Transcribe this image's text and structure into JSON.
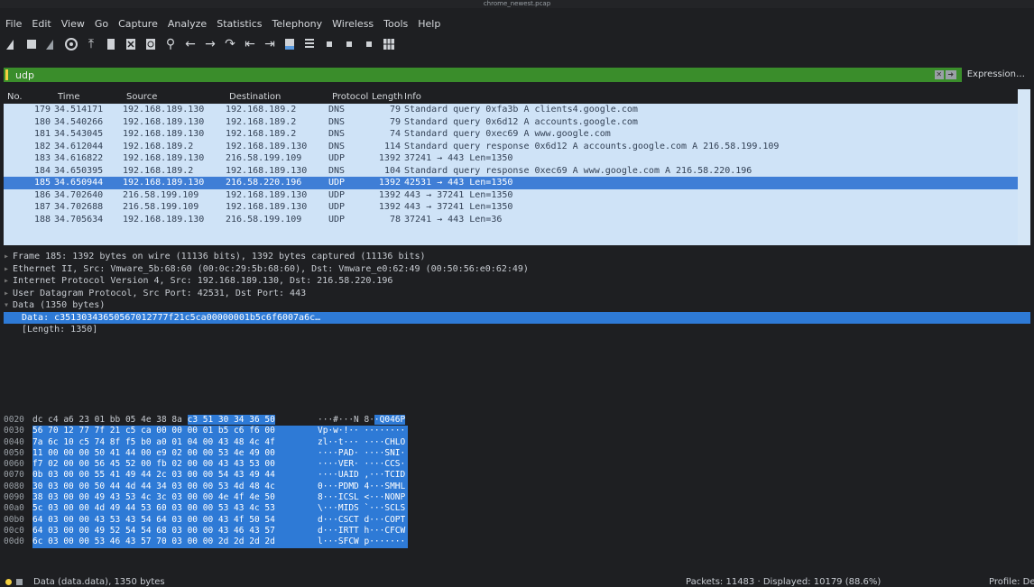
{
  "window": {
    "title": "chrome_newest.pcap"
  },
  "menu": [
    "File",
    "Edit",
    "View",
    "Go",
    "Capture",
    "Analyze",
    "Statistics",
    "Telephony",
    "Wireless",
    "Tools",
    "Help"
  ],
  "toolbar": {
    "icons": [
      "shark-fin-start-icon",
      "stop-square-icon",
      "shark-fin-restart-icon",
      "gear-icon",
      "open-icon",
      "file-icon",
      "close-file-icon",
      "reload-icon",
      "search-icon",
      "back-arrow-icon",
      "forward-arrow-icon",
      "jump-icon",
      "first-packet-icon",
      "last-packet-icon",
      "autoscroll-icon",
      "colorize-icon",
      "zoom-in-icon",
      "zoom-out-icon",
      "zoom-normal-icon",
      "resize-columns-icon"
    ]
  },
  "filter": {
    "value": "udp",
    "expression_label": "Expression…"
  },
  "packet_list": {
    "columns": [
      "No.",
      "Time",
      "Source",
      "Destination",
      "Protocol",
      "Length",
      "Info"
    ],
    "rows": [
      [
        "179",
        "34.514171",
        "192.168.189.130",
        "192.168.189.2",
        "DNS",
        "79",
        "Standard query 0xfa3b A clients4.google.com"
      ],
      [
        "180",
        "34.540266",
        "192.168.189.130",
        "192.168.189.2",
        "DNS",
        "79",
        "Standard query 0x6d12 A accounts.google.com"
      ],
      [
        "181",
        "34.543045",
        "192.168.189.130",
        "192.168.189.2",
        "DNS",
        "74",
        "Standard query 0xec69 A www.google.com"
      ],
      [
        "182",
        "34.612044",
        "192.168.189.2",
        "192.168.189.130",
        "DNS",
        "114",
        "Standard query response 0x6d12 A accounts.google.com A 216.58.199.109"
      ],
      [
        "183",
        "34.616822",
        "192.168.189.130",
        "216.58.199.109",
        "UDP",
        "1392",
        "37241 → 443 Len=1350"
      ],
      [
        "184",
        "34.650395",
        "192.168.189.2",
        "192.168.189.130",
        "DNS",
        "104",
        "Standard query response 0xec69 A www.google.com A 216.58.220.196"
      ],
      [
        "185",
        "34.650944",
        "192.168.189.130",
        "216.58.220.196",
        "UDP",
        "1392",
        "42531 → 443 Len=1350"
      ],
      [
        "186",
        "34.702640",
        "216.58.199.109",
        "192.168.189.130",
        "UDP",
        "1392",
        "443 → 37241 Len=1350"
      ],
      [
        "187",
        "34.702688",
        "216.58.199.109",
        "192.168.189.130",
        "UDP",
        "1392",
        "443 → 37241 Len=1350"
      ],
      [
        "188",
        "34.705634",
        "192.168.189.130",
        "216.58.199.109",
        "UDP",
        "78",
        "37241 → 443 Len=36"
      ]
    ],
    "selected_index": 6
  },
  "details": [
    "Frame 185: 1392 bytes on wire (11136 bits), 1392 bytes captured (11136 bits)",
    "Ethernet II, Src: Vmware_5b:68:60 (00:0c:29:5b:68:60), Dst: Vmware_e0:62:49 (00:50:56:e0:62:49)",
    "Internet Protocol Version 4, Src: 192.168.189.130, Dst: 216.58.220.196",
    "User Datagram Protocol, Src Port: 42531, Dst Port: 443",
    "Data (1350 bytes)",
    "Data: c35130343650567012777f21c5ca00000001b5c6f6007a6c…",
    "[Length: 1350]"
  ],
  "bytes": [
    {
      "off": "0020",
      "hex": "dc c4 a6 23 01 bb 05 4e  38 8a c3 51 30 34 36 50",
      "ascii": "···#···N 8··Q046P"
    },
    {
      "off": "0030",
      "hex": "56 70 12 77 7f 21 c5 ca  00 00 00 01 b5 c6 f6 00",
      "ascii": "Vp·w·!·· ········"
    },
    {
      "off": "0040",
      "hex": "7a 6c 10 c5 74 8f f5 b0  a0 01 04 00 43 48 4c 4f",
      "ascii": "zl··t··· ····CHLO"
    },
    {
      "off": "0050",
      "hex": "11 00 00 00 50 41 44 00  e9 02 00 00 53 4e 49 00",
      "ascii": "····PAD· ····SNI·"
    },
    {
      "off": "0060",
      "hex": "f7 02 00 00 56 45 52 00  fb 02 00 00 43 43 53 00",
      "ascii": "····VER· ····CCS·"
    },
    {
      "off": "0070",
      "hex": "0b 03 00 00 55 41 49 44  2c 03 00 00 54 43 49 44",
      "ascii": "····UAID ,···TCID"
    },
    {
      "off": "0080",
      "hex": "30 03 00 00 50 44 4d 44  34 03 00 00 53 4d 48 4c",
      "ascii": "0···PDMD 4···SMHL"
    },
    {
      "off": "0090",
      "hex": "38 03 00 00 49 43 53 4c  3c 03 00 00 4e 4f 4e 50",
      "ascii": "8···ICSL <···NONP"
    },
    {
      "off": "00a0",
      "hex": "5c 03 00 00 4d 49 44 53  60 03 00 00 53 43 4c 53",
      "ascii": "\\···MIDS `···SCLS"
    },
    {
      "off": "00b0",
      "hex": "64 03 00 00 43 53 43 54  64 03 00 00 43 4f 50 54",
      "ascii": "d···CSCT d···COPT"
    },
    {
      "off": "00c0",
      "hex": "64 03 00 00 49 52 54 54  68 03 00 00 43 46 43 57",
      "ascii": "d···IRTT h···CFCW"
    },
    {
      "off": "00d0",
      "hex": "6c 03 00 00 53 46 43 57  70 03 00 00 2d 2d 2d 2d",
      "ascii": "l···SFCW p·······"
    }
  ],
  "status": {
    "left": "Data (data.data), 1350 bytes",
    "middle": "Packets: 11483 · Displayed: 10179 (88.6%)",
    "right": "Profile: Defa"
  },
  "colors": {
    "filter_bg": "#3a8d2b",
    "row_bg": "#cfe3f7",
    "selected": "#3f7ed6"
  }
}
